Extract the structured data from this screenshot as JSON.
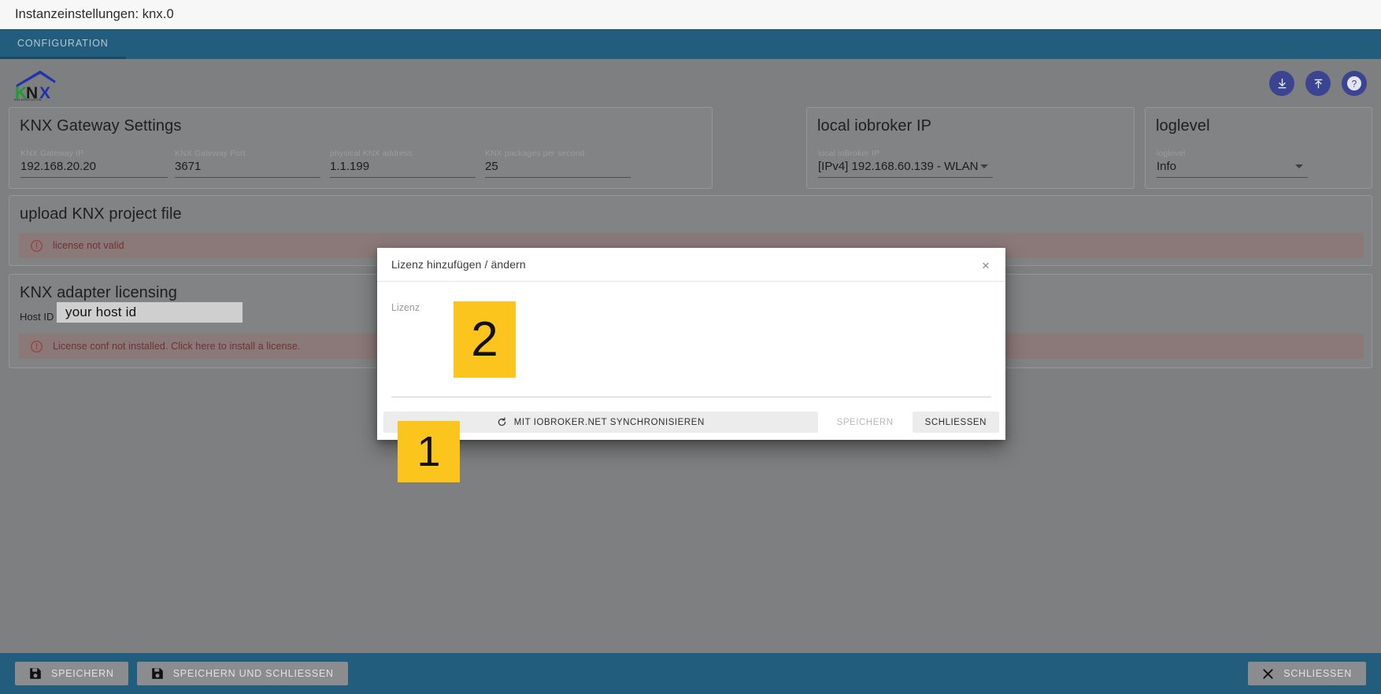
{
  "window": {
    "title": "Instanzeinstellungen: knx.0"
  },
  "tabs": [
    {
      "label": "CONFIGURATION",
      "active": true
    }
  ],
  "brand": {
    "logo_name": "KNX",
    "logo_tagline": "KNX ASSOCIATION",
    "colors": {
      "k": "#1f9b35",
      "n": "#1a1a1a",
      "x": "#2030b0",
      "roof": "#2030b0"
    }
  },
  "top_actions": [
    {
      "name": "download-icon",
      "label": "download"
    },
    {
      "name": "upload-icon",
      "label": "upload"
    },
    {
      "name": "help-icon",
      "label": "help"
    }
  ],
  "panels": {
    "gateway": {
      "title": "KNX Gateway Settings",
      "fields": [
        {
          "label": "KNX Gateway IP",
          "value": "192.168.20.20"
        },
        {
          "label": "KNX Gateway Port",
          "value": "3671"
        },
        {
          "label": "physical KNX address",
          "value": "1.1.199"
        },
        {
          "label": "KNX packages per second",
          "value": "25"
        }
      ]
    },
    "local_ip": {
      "title": "local iobroker IP",
      "field": {
        "label": "local ioBroker IP",
        "value": "[IPv4] 192.168.60.139 - WLAN"
      }
    },
    "loglevel": {
      "title": "loglevel",
      "field": {
        "label": "loglevel",
        "value": "Info"
      }
    },
    "upload_project": {
      "title": "upload KNX project file",
      "alert": "license not valid"
    },
    "licensing": {
      "title": "KNX adapter licensing",
      "host_id_label": "Host ID :",
      "host_id_value": "your  host id",
      "alert": "License conf not installed. Click here to install a license."
    }
  },
  "modal": {
    "title": "Lizenz hinzufügen / ändern",
    "close_icon": "×",
    "field_label": "Lizenz",
    "field_value": "",
    "buttons": {
      "sync": "MIT IOBROKER.NET SYNCHRONISIEREN",
      "sync_icon": "refresh-icon",
      "save": "SPEICHERN",
      "close": "SCHLIESSEN"
    }
  },
  "bottombar": {
    "save": "SPEICHERN",
    "save_and_close": "SPEICHERN UND SCHLIESSEN",
    "close": "SCHLIESSEN"
  },
  "annotations": [
    {
      "id": "1",
      "label": "1"
    },
    {
      "id": "2",
      "label": "2"
    }
  ],
  "colors": {
    "accent": "#225d7d",
    "badge": "#fbc51d",
    "error": "#6e3232",
    "icon_circle": "#3b4491"
  }
}
